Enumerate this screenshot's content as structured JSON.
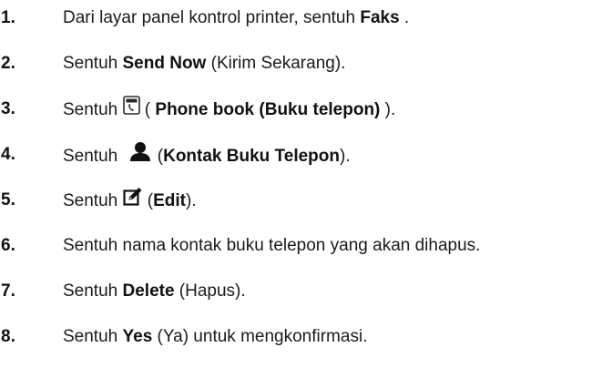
{
  "steps": [
    {
      "number": "1.",
      "before": "Dari layar panel kontrol printer, sentuh ",
      "bold": "Faks",
      "after": " ."
    },
    {
      "number": "2.",
      "before": "Sentuh ",
      "bold": "Send Now",
      "after": " (Kirim Sekarang)."
    },
    {
      "number": "3.",
      "before": "Sentuh ",
      "icon": "phone-book-icon",
      "mid": " ( ",
      "bold": "Phone book (Buku telepon)",
      "after": " )."
    },
    {
      "number": "4.",
      "before": "Sentuh ",
      "icon": "contact-person-icon",
      "mid": " (",
      "bold": "Kontak Buku Telepon",
      "after": ")."
    },
    {
      "number": "5.",
      "before": "Sentuh ",
      "icon": "edit-icon",
      "mid": " (",
      "bold": "Edit",
      "after": ")."
    },
    {
      "number": "6.",
      "before": "Sentuh nama kontak buku telepon yang akan dihapus."
    },
    {
      "number": "7.",
      "before": "Sentuh ",
      "bold": "Delete",
      "after": " (Hapus)."
    },
    {
      "number": "8.",
      "before": "Sentuh ",
      "bold": "Yes",
      "after": " (Ya) untuk mengkonfirmasi."
    }
  ]
}
